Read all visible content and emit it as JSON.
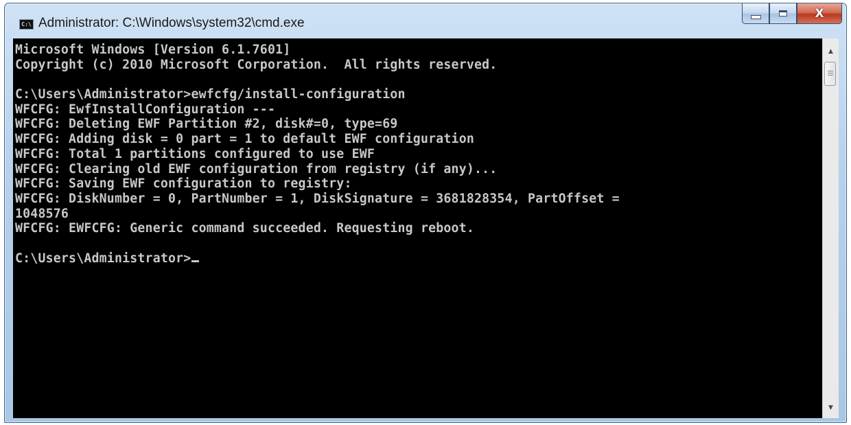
{
  "window": {
    "title": "Administrator: C:\\Windows\\system32\\cmd.exe",
    "icon": "cmd-icon",
    "icon_text": "C:\\",
    "controls": {
      "minimize": "minimize-icon",
      "maximize": "maximize-icon",
      "close": "close-icon",
      "close_glyph": "X"
    }
  },
  "console": {
    "lines": [
      "Microsoft Windows [Version 6.1.7601]",
      "Copyright (c) 2010 Microsoft Corporation.  All rights reserved.",
      "",
      "C:\\Users\\Administrator>ewfcfg/install-configuration",
      "WFCFG: EwfInstallConfiguration ---",
      "WFCFG: Deleting EWF Partition #2, disk#=0, type=69",
      "WFCFG: Adding disk = 0 part = 1 to default EWF configuration",
      "WFCFG: Total 1 partitions configured to use EWF",
      "WFCFG: Clearing old EWF configuration from registry (if any)...",
      "WFCFG: Saving EWF configuration to registry:",
      "WFCFG: DiskNumber = 0, PartNumber = 1, DiskSignature = 3681828354, PartOffset =",
      "1048576",
      "WFCFG: EWFCFG: Generic command succeeded. Requesting reboot.",
      "",
      "C:\\Users\\Administrator>"
    ]
  },
  "scrollbar": {
    "up_icon": "scroll-up-arrow-icon",
    "down_icon": "scroll-down-arrow-icon",
    "up_glyph": "▲",
    "down_glyph": "▼"
  },
  "colors": {
    "console_bg": "#000000",
    "console_fg": "#c8c8c8",
    "close_red": "#c8452c",
    "frame_blue": "#b7d1ec"
  }
}
